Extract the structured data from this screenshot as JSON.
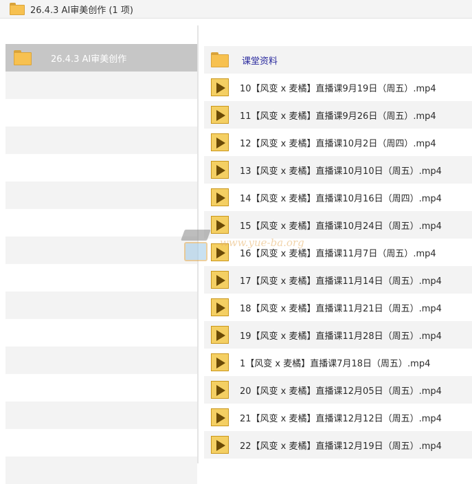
{
  "window": {
    "title": "26.4.3 AI审美创作 (1 项)",
    "folder_icon": "folder-icon"
  },
  "left_pane": {
    "selected_item": {
      "label": "26.4.3 AI审美创作",
      "icon": "folder-icon"
    }
  },
  "right_pane": {
    "folder": {
      "label": "课堂资料",
      "icon": "folder-icon"
    },
    "files": [
      {
        "label": "10【风变 x 麦橘】直播课9月19日（周五）.mp4",
        "icon": "video-file-icon"
      },
      {
        "label": "11【风变 x 麦橘】直播课9月26日（周五）.mp4",
        "icon": "video-file-icon"
      },
      {
        "label": "12【风变 x 麦橘】直播课10月2日（周四）.mp4",
        "icon": "video-file-icon"
      },
      {
        "label": "13【风变 x 麦橘】直播课10月10日（周五）.mp4",
        "icon": "video-file-icon"
      },
      {
        "label": "14【风变 x 麦橘】直播课10月16日（周四）.mp4",
        "icon": "video-file-icon"
      },
      {
        "label": "15【风变 x 麦橘】直播课10月24日（周五）.mp4",
        "icon": "video-file-icon"
      },
      {
        "label": "16【风变 x 麦橘】直播课11月7日（周五）.mp4",
        "icon": "video-file-icon"
      },
      {
        "label": "17【风变 x 麦橘】直播课11月14日（周五）.mp4",
        "icon": "video-file-icon"
      },
      {
        "label": "18【风变 x 麦橘】直播课11月21日（周五）.mp4",
        "icon": "video-file-icon"
      },
      {
        "label": "19【风变 x 麦橘】直播课11月28日（周五）.mp4",
        "icon": "video-file-icon"
      },
      {
        "label": "1【风变 x 麦橘】直播课7月18日（周五）.mp4",
        "icon": "video-file-icon"
      },
      {
        "label": "20【风变 x 麦橘】直播课12月05日（周五）.mp4",
        "icon": "video-file-icon"
      },
      {
        "label": "21【风变 x 麦橘】直播课12月12日（周五）.mp4",
        "icon": "video-file-icon"
      },
      {
        "label": "22【风变 x 麦橘】直播课12月19日（周五）.mp4",
        "icon": "video-file-icon"
      }
    ]
  },
  "watermark": {
    "text": "www.yue-ba.org"
  },
  "colors": {
    "selected_bg": "#c6c6c6",
    "stripe_bg": "#f3f3f3",
    "folder_fill": "#f7c150",
    "folder_label": "#2a2a9e",
    "video_icon_fill": "#f4cf63"
  }
}
